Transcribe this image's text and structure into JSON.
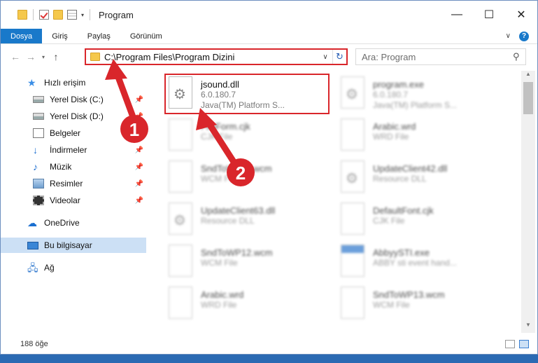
{
  "window": {
    "title": "Program"
  },
  "ribbon": {
    "tabs": [
      "Dosya",
      "Giriş",
      "Paylaş",
      "Görünüm"
    ]
  },
  "address": {
    "path": "C:\\Program Files\\Program Dizini"
  },
  "search": {
    "placeholder": "Ara: Program"
  },
  "navpane": {
    "items": [
      {
        "label": "Hızlı erişim",
        "icon": "star-icon"
      },
      {
        "label": "Yerel Disk (C:)",
        "icon": "drive-icon",
        "pinned": true
      },
      {
        "label": "Yerel Disk (D:)",
        "icon": "drive-icon",
        "pinned": true
      },
      {
        "label": "Belgeler",
        "icon": "documents-icon",
        "pinned": true
      },
      {
        "label": "İndirmeler",
        "icon": "download-icon",
        "pinned": true
      },
      {
        "label": "Müzik",
        "icon": "music-icon",
        "pinned": true
      },
      {
        "label": "Resimler",
        "icon": "pictures-icon",
        "pinned": true
      },
      {
        "label": "Videolar",
        "icon": "videos-icon",
        "pinned": true
      },
      {
        "label": "OneDrive",
        "icon": "cloud-icon"
      },
      {
        "label": "Bu bilgisayar",
        "icon": "computer-icon",
        "selected": true
      },
      {
        "label": "Ağ",
        "icon": "network-icon"
      }
    ]
  },
  "files": [
    {
      "name": "jsound.dll",
      "line2": "6.0.180.7",
      "line3": "Java(TM) Platform S...",
      "highlighted": true
    },
    {
      "name": "program.exe",
      "line2": "6.0.180.7",
      "line3": "Java(TM) Platform S...",
      "blurred": true
    },
    {
      "name": "FileForm.cjk",
      "line2": "CJK File",
      "blurred": true
    },
    {
      "name": "Arabic.wrd",
      "line2": "WRD File",
      "blurred": true
    },
    {
      "name": "SndToWP11.wcm",
      "line2": "WCM File",
      "blurred": true
    },
    {
      "name": "UpdateClient42.dll",
      "line2": "Resource DLL",
      "blurred": true
    },
    {
      "name": "UpdateClient63.dll",
      "line2": "Resource DLL",
      "blurred": true
    },
    {
      "name": "DefaultFont.cjk",
      "line2": "CJK File",
      "blurred": true
    },
    {
      "name": "SndToWP12.wcm",
      "line2": "WCM File",
      "blurred": true
    },
    {
      "name": "AbbyySTI.exe",
      "line2": "ABBY sti event hand...",
      "blurred": true
    },
    {
      "name": "Arabic.wrd",
      "line2": "WRD File",
      "blurred": true
    },
    {
      "name": "SndToWP13.wcm",
      "line2": "WCM File",
      "blurred": true
    }
  ],
  "status": {
    "count": "188 öğe"
  },
  "annotations": {
    "color": "#d9262b",
    "badges": [
      "1",
      "2"
    ]
  }
}
